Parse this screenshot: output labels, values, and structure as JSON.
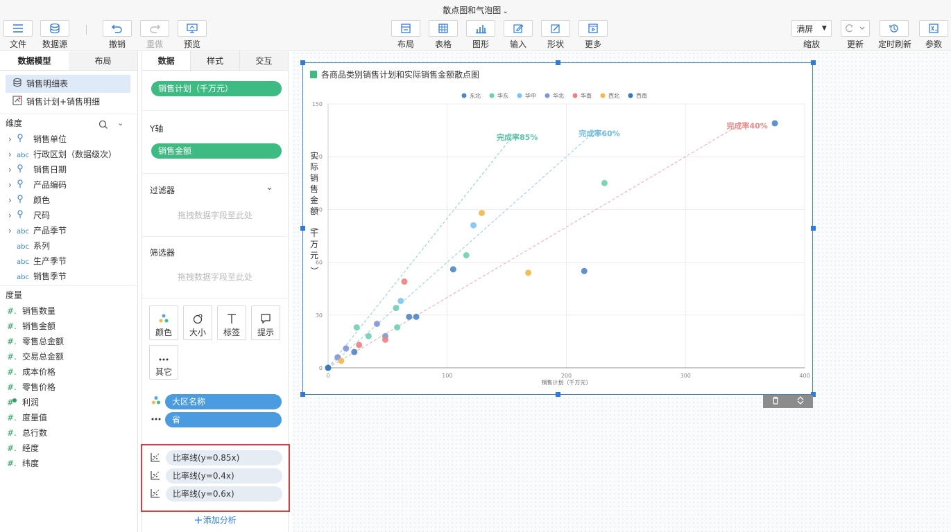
{
  "doc": {
    "title": "散点图和气泡图",
    "chevron": "⌄"
  },
  "toolbar": {
    "left": [
      {
        "name": "file",
        "label": "文件",
        "icon": "menu-icon"
      },
      {
        "name": "datasource",
        "label": "数据源",
        "icon": "database-icon"
      },
      {
        "name": "undo",
        "label": "撤销",
        "icon": "undo-icon"
      },
      {
        "name": "redo",
        "label": "重做",
        "icon": "redo-icon"
      },
      {
        "name": "preview",
        "label": "预览",
        "icon": "monitor-icon"
      }
    ],
    "center": [
      {
        "name": "layout",
        "label": "布局",
        "icon": "layout-icon"
      },
      {
        "name": "table",
        "label": "表格",
        "icon": "grid-icon"
      },
      {
        "name": "graph",
        "label": "图形",
        "icon": "bar-chart-icon"
      },
      {
        "name": "input",
        "label": "输入",
        "icon": "edit-icon"
      },
      {
        "name": "shape",
        "label": "形状",
        "icon": "pen-icon"
      },
      {
        "name": "more",
        "label": "更多",
        "icon": "play-box-icon"
      }
    ],
    "right": {
      "zoom_value": "满屏",
      "zoom_label": "缩放",
      "update_label": "更新",
      "timer_label": "定时刷新",
      "params_label": "参数"
    }
  },
  "left_panel": {
    "tabs": [
      "数据模型",
      "布局"
    ],
    "tables": [
      "销售明细表",
      "销售计划+销售明细"
    ],
    "dimension_title": "维度",
    "dimensions": [
      {
        "label": "销售单位",
        "type": "geo",
        "expand": true
      },
      {
        "label": "行政区划（数据级次）",
        "type": "abc",
        "expand": true
      },
      {
        "label": "销售日期",
        "type": "geo",
        "expand": true
      },
      {
        "label": "产品编码",
        "type": "geo",
        "expand": true
      },
      {
        "label": "颜色",
        "type": "geo",
        "expand": true
      },
      {
        "label": "尺码",
        "type": "geo",
        "expand": true
      },
      {
        "label": "产品季节",
        "type": "abc",
        "expand": true
      },
      {
        "label": "系列",
        "type": "abc",
        "expand": false
      },
      {
        "label": "生产季节",
        "type": "abc",
        "expand": false
      },
      {
        "label": "销售季节",
        "type": "abc",
        "expand": false
      }
    ],
    "measure_title": "度量",
    "measures": [
      "销售数量",
      "销售金额",
      "零售总金额",
      "交易总金额",
      "成本价格",
      "零售价格",
      "利润",
      "度量值",
      "总行数",
      "经度",
      "纬度"
    ]
  },
  "mid_panel": {
    "tabs": [
      "数据",
      "样式",
      "交互"
    ],
    "x_field": "销售计划（千万元）",
    "y_label": "Y轴",
    "y_field": "销售金额",
    "filter_label": "过滤器",
    "filter_placeholder": "拖拽数据字段至此处",
    "selector_label": "筛选器",
    "selector_placeholder": "拖拽数据字段至此处",
    "marks": [
      "颜色",
      "大小",
      "标签",
      "提示",
      "其它"
    ],
    "color_field": "大区名称",
    "other_field": "省",
    "ratio_lines": [
      "比率线(y=0.85x)",
      "比率线(y=0.4x)",
      "比率线(y=0.6x)"
    ],
    "add_analysis": "添加分析"
  },
  "chart_data": {
    "type": "scatter",
    "title": "各商品类别销售计划和实际销售金额散点图",
    "xlabel": "销售计划（千万元）",
    "ylabel": "实际销售金额（千万元）",
    "xlim": [
      0,
      400
    ],
    "ylim": [
      0,
      150
    ],
    "xticks": [
      0,
      100,
      200,
      300,
      400
    ],
    "yticks": [
      0,
      30,
      60,
      90,
      120,
      150
    ],
    "legend_position": "top",
    "series": [
      {
        "name": "东北",
        "color": "#4e86c6",
        "points": [
          [
            105,
            56
          ],
          [
            215,
            55
          ],
          [
            375,
            139
          ],
          [
            68,
            29
          ],
          [
            74,
            29
          ],
          [
            22,
            9
          ],
          [
            0,
            0
          ]
        ]
      },
      {
        "name": "华东",
        "color": "#6fcfb0",
        "points": [
          [
            232,
            105
          ],
          [
            116,
            64
          ],
          [
            57,
            34
          ],
          [
            58,
            23
          ],
          [
            34,
            18
          ],
          [
            24,
            23
          ]
        ]
      },
      {
        "name": "华中",
        "color": "#7cc5f2",
        "points": [
          [
            122,
            81
          ],
          [
            61,
            38
          ]
        ]
      },
      {
        "name": "华北",
        "color": "#7f95dc",
        "points": [
          [
            41,
            25
          ],
          [
            48,
            18
          ],
          [
            15,
            11
          ],
          [
            8,
            6
          ]
        ]
      },
      {
        "name": "华南",
        "color": "#ee8080",
        "points": [
          [
            64,
            49
          ],
          [
            48,
            16
          ],
          [
            26,
            13
          ]
        ]
      },
      {
        "name": "西北",
        "color": "#f2b84b",
        "points": [
          [
            129,
            88
          ],
          [
            168,
            54
          ],
          [
            11,
            4
          ]
        ]
      },
      {
        "name": "西南",
        "color": "#3a76be",
        "points": [
          [
            0,
            0
          ]
        ]
      }
    ],
    "ratio_lines": [
      {
        "label": "完成率85%",
        "slope": 0.85,
        "color": "#58c6a5",
        "x_end": 157
      },
      {
        "label": "完成率60%",
        "slope": 0.6,
        "color": "#6cbbe5",
        "x_end": 226
      },
      {
        "label": "完成率40%",
        "slope": 0.4,
        "color": "#ea8a8a",
        "x_end": 350
      }
    ]
  }
}
